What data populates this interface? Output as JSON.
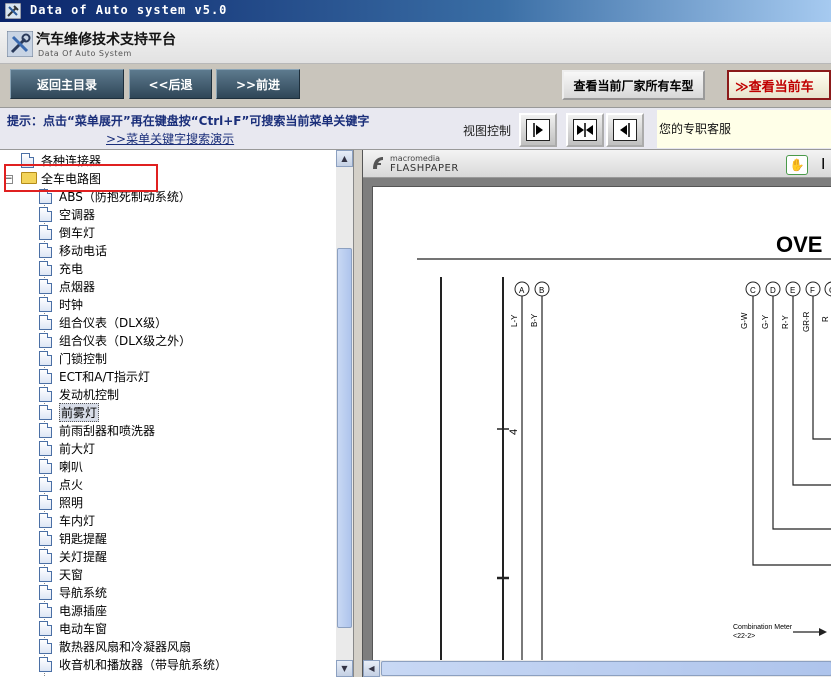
{
  "window": {
    "title": "Data of Auto system v5.0"
  },
  "header": {
    "title_cn": "汽车维修技术支持平台",
    "title_en": "Data Of Auto System"
  },
  "toolbar": {
    "home_label": "返回主目录",
    "back_label": "<<后退",
    "forward_label": ">>前进",
    "all_models_label": "查看当前厂家所有车型",
    "current_model_label": "≫查看当前车"
  },
  "hint": {
    "text": "提示：点击“菜单展开”再在键盘按“Ctrl+F”可搜索当前菜单关键字",
    "link": ">>菜单关键字搜索演示"
  },
  "view_control": {
    "label": "视图控制"
  },
  "support": {
    "label": "您的专职客服"
  },
  "tree": {
    "above": "各种连接器",
    "root": "全车电路图",
    "selected_index": 12,
    "items": [
      "ABS（防抱死制动系统）",
      "空调器",
      "倒车灯",
      "移动电话",
      "充电",
      "点烟器",
      "时钟",
      "组合仪表（DLX级）",
      "组合仪表（DLX级之外）",
      "门锁控制",
      "ECT和A/T指示灯",
      "发动机控制",
      "前雾灯",
      "前雨刮器和喷洗器",
      "前大灯",
      "喇叭",
      "点火",
      "照明",
      "车内灯",
      "钥匙提醒",
      "关灯提醒",
      "天窗",
      "导航系统",
      "电源插座",
      "电动车窗",
      "散热器风扇和冷凝器风扇",
      "收音机和播放器（带导航系统）"
    ]
  },
  "viewer": {
    "brand_small": "macromedia",
    "brand_name": "FLASHPAPER",
    "page": {
      "heading": "OVE",
      "connector_letters_left": [
        "A",
        "B"
      ],
      "connector_letters_right": [
        "C",
        "D",
        "E",
        "F",
        "G"
      ],
      "wire_labels_left": [
        "L-Y",
        "B-Y"
      ],
      "wire_labels_right": [
        "G-W",
        "G-Y",
        "R-Y",
        "GR-R",
        "R"
      ],
      "pin_number": "4",
      "annotation_line1": "Combination Meter",
      "annotation_line2": "<22-2>"
    }
  },
  "colors": {
    "titlebar": "#0a246a",
    "hint_text": "#1a2e7a",
    "highlight": "#e02020",
    "current_model_text": "#c00000"
  }
}
